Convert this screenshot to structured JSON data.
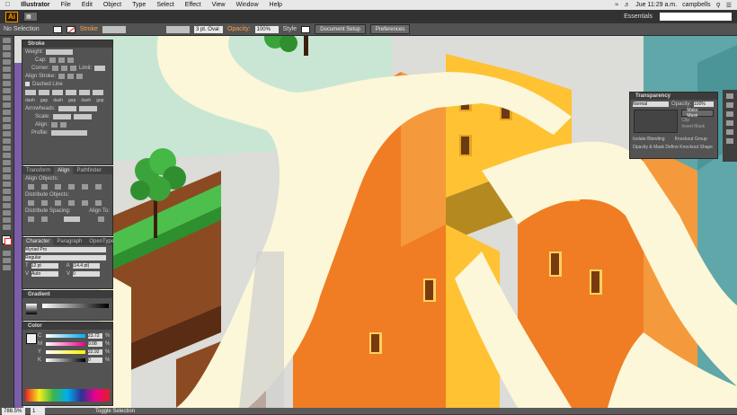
{
  "menubar": {
    "app": "Illustrator",
    "items": [
      "File",
      "Edit",
      "Object",
      "Type",
      "Select",
      "Effect",
      "View",
      "Window",
      "Help"
    ],
    "clock": "Jue 11:29 a.m.",
    "user": "campbells"
  },
  "appbar": {
    "logo": "Ai",
    "workspace": "Essentials"
  },
  "control": {
    "selection": "No Selection",
    "stroke_label": "Stroke",
    "brush": "3 pt. Oval",
    "opacity_label": "Opacity:",
    "opacity_value": "100%",
    "style_label": "Style",
    "doc_setup": "Document Setup",
    "preferences": "Preferences"
  },
  "stroke_panel": {
    "title": "Stroke",
    "weight": "Weight:",
    "cap": "Cap:",
    "corner": "Corner:",
    "limit": "Limit:",
    "align": "Align Stroke:",
    "dashed": "Dashed Line",
    "dash_labels": [
      "dash",
      "gap",
      "dash",
      "gap",
      "dash",
      "gap"
    ],
    "arrowheads": "Arrowheads:",
    "scale": "Scale:",
    "align2": "Align:",
    "profile": "Profile:"
  },
  "align_panel": {
    "tabs": [
      "Transform",
      "Align",
      "Pathfinder"
    ],
    "align_objects": "Align Objects:",
    "distribute_objects": "Distribute Objects:",
    "distribute_spacing": "Distribute Spacing:",
    "align_to": "Align To:"
  },
  "character_panel": {
    "tabs": [
      "Character",
      "Paragraph",
      "OpenType"
    ],
    "font": "Myriad Pro",
    "style": "Regular",
    "size": "12 pt",
    "leading": "(14.4 pt)",
    "kerning": "Auto",
    "tracking": "0"
  },
  "gradient_panel": {
    "title": "Gradient"
  },
  "color_panel": {
    "title": "Color",
    "channels": [
      {
        "label": "C",
        "value": "23.72",
        "color": "#00aeef"
      },
      {
        "label": "M",
        "value": "0.08",
        "color": "#ec008c"
      },
      {
        "label": "Y",
        "value": "22.92",
        "color": "#fff200"
      },
      {
        "label": "K",
        "value": "0",
        "color": "#000000"
      }
    ],
    "pct": "%"
  },
  "transparency_panel": {
    "title": "Transparency",
    "mode": "Normal",
    "opacity_label": "Opacity:",
    "opacity_value": "100%",
    "make_mask": "Make Mask",
    "clip": "Clip",
    "invert": "Invert Mask",
    "isolate": "Isolate Blending",
    "knockout": "Knockout Group",
    "opacity_mask": "Opacity & Mask Define Knockout Shape"
  },
  "status": {
    "zoom": "788.5%",
    "page": "1",
    "tool": "Toggle Selection"
  },
  "colors": {
    "orange": "#f07d23",
    "cream": "#fbf7d8",
    "yellow": "#ffc233",
    "green": "#3aa43a",
    "teal": "#5aa3a8"
  }
}
